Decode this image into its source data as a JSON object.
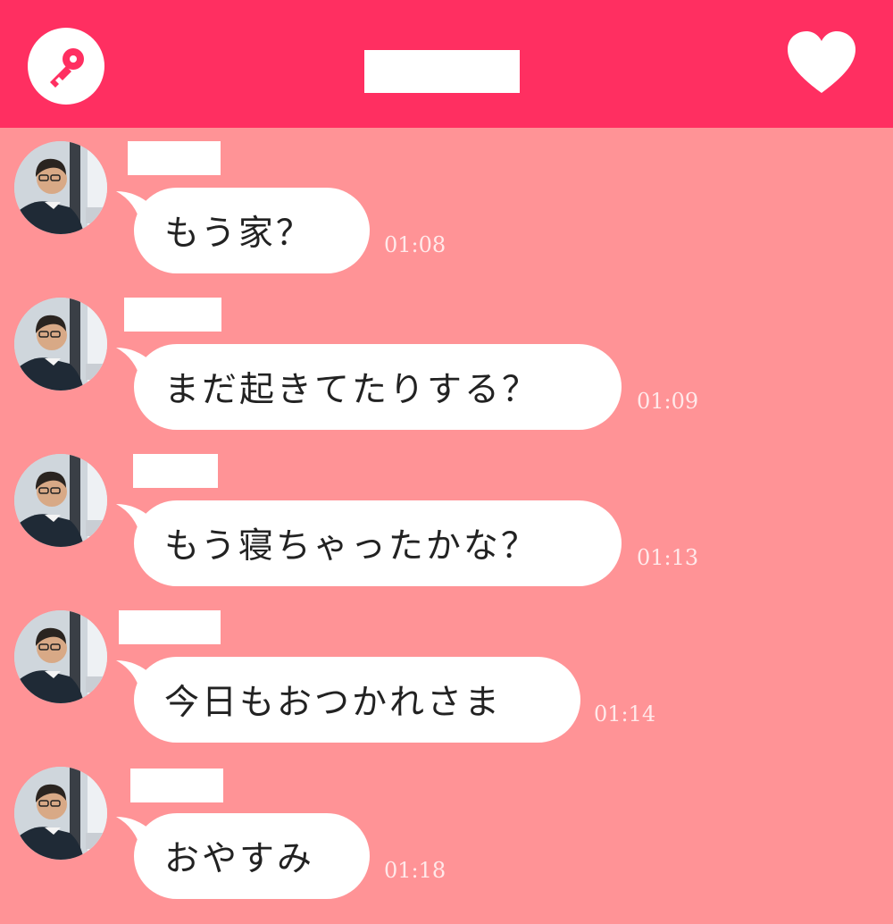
{
  "header": {
    "left_icon": "key-icon",
    "right_icon": "heart-icon",
    "accent_color": "#ff2f61",
    "background_color": "#ff9396"
  },
  "messages": [
    {
      "text": "もう家？",
      "time": "01:08"
    },
    {
      "text": "まだ起きてたりする？",
      "time": "01:09"
    },
    {
      "text": "もう寝ちゃったかな？",
      "time": "01:13"
    },
    {
      "text": "今日もおつかれさま",
      "time": "01:14"
    },
    {
      "text": "おやすみ",
      "time": "01:18"
    }
  ]
}
